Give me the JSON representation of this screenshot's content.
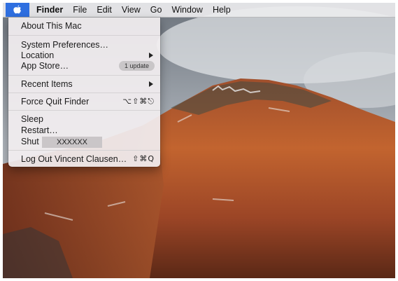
{
  "menubar": {
    "app_name": "Finder",
    "items": [
      "File",
      "Edit",
      "View",
      "Go",
      "Window",
      "Help"
    ]
  },
  "apple_menu": {
    "about": "About This Mac",
    "system_preferences": "System Preferences…",
    "location": "Location",
    "app_store": "App Store…",
    "app_store_badge": "1 update",
    "recent_items": "Recent Items",
    "force_quit": "Force Quit Finder",
    "force_quit_shortcut": "⌥⇧⌘⎋",
    "sleep": "Sleep",
    "restart": "Restart…",
    "shut_down": "Shut",
    "redacted": "XXXXXX",
    "log_out": "Log Out Vincent Clausen…",
    "log_out_shortcut": "⇧⌘Q"
  },
  "colors": {
    "menubar_bg": "#ececee",
    "apple_highlight": "#2f6fe0",
    "menu_bg": "#f2eef0"
  }
}
